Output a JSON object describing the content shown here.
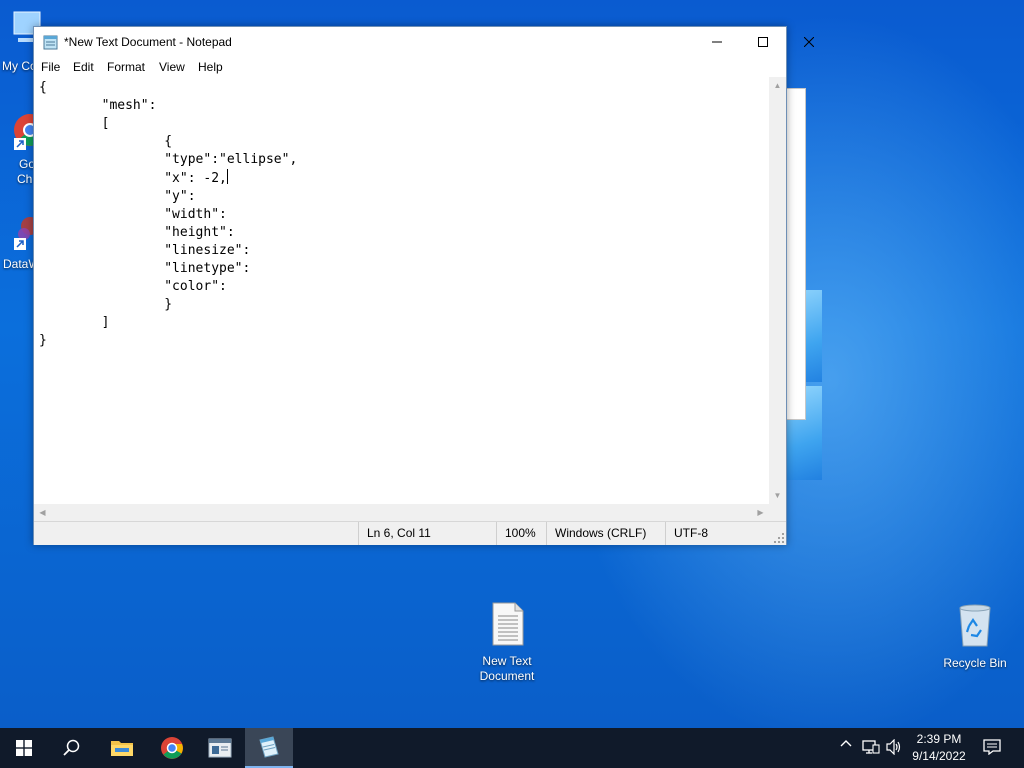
{
  "desktop": {
    "icons": [
      {
        "label_line1": "New Text",
        "label_line2": "Document"
      },
      {
        "label_line1": "Recycle Bin"
      }
    ],
    "left_partial": {
      "my_computer": "My Co",
      "chrome_line1": "Go",
      "chrome_line2": "Ch",
      "datawrangler": "DataW"
    }
  },
  "notepad": {
    "title": "*New Text Document - Notepad",
    "menu": [
      "File",
      "Edit",
      "Format",
      "View",
      "Help"
    ],
    "content_before_caret": "{\n\t\"mesh\":\n\t[\n\t\t{\n\t\t\"type\":\"ellipse\",\n\t\t\"x\": -2,",
    "content_after_caret": "\n\t\t\"y\":\n\t\t\"width\":\n\t\t\"height\":\n\t\t\"linesize\":\n\t\t\"linetype\":\n\t\t\"color\":\n\t\t}\n\t]\n}",
    "status": {
      "position": "Ln 6, Col 11",
      "zoom": "100%",
      "line_ending": "Windows (CRLF)",
      "encoding": "UTF-8"
    }
  },
  "taskbar": {
    "time": "2:39 PM",
    "date": "9/14/2022"
  },
  "colors": {
    "desktop_blue": "#0b6fdc",
    "taskbar": "#101a2a"
  }
}
